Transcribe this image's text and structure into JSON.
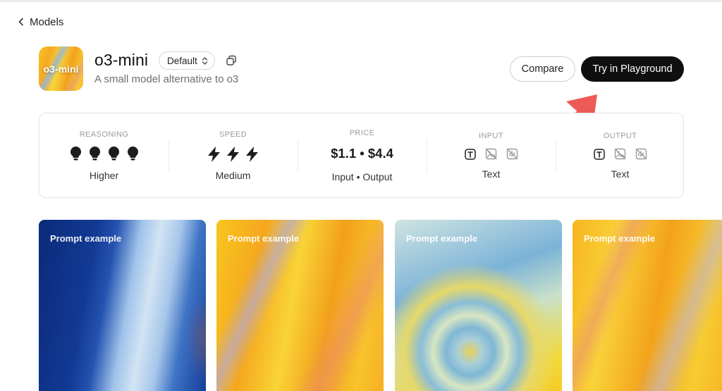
{
  "nav": {
    "back_label": "Models"
  },
  "model": {
    "icon_text": "o3-mini",
    "name": "o3-mini",
    "variant": "Default",
    "description": "A small model alternative to o3"
  },
  "actions": {
    "compare_label": "Compare",
    "playground_label": "Try in Playground"
  },
  "stats": {
    "reasoning": {
      "label": "REASONING",
      "value": "Higher",
      "level_filled": 4,
      "level_max": 4
    },
    "speed": {
      "label": "SPEED",
      "value": "Medium",
      "level_filled": 3,
      "level_max": 3
    },
    "price": {
      "label": "PRICE",
      "value": "$1.1 • $4.4",
      "caption": "Input • Output"
    },
    "input": {
      "label": "INPUT",
      "value": "Text",
      "modalities": [
        "text-icon",
        "image-disabled-icon",
        "audio-disabled-icon"
      ]
    },
    "output": {
      "label": "OUTPUT",
      "value": "Text",
      "modalities": [
        "text-icon",
        "image-disabled-icon",
        "audio-disabled-icon"
      ]
    }
  },
  "prompt_examples": [
    {
      "label": "Prompt example"
    },
    {
      "label": "Prompt example"
    },
    {
      "label": "Prompt example"
    },
    {
      "label": "Prompt example"
    }
  ],
  "colors": {
    "primary_button": "#0f0f0f",
    "annotation_arrow": "#ee5a55",
    "muted_text": "#6e6e6e"
  }
}
